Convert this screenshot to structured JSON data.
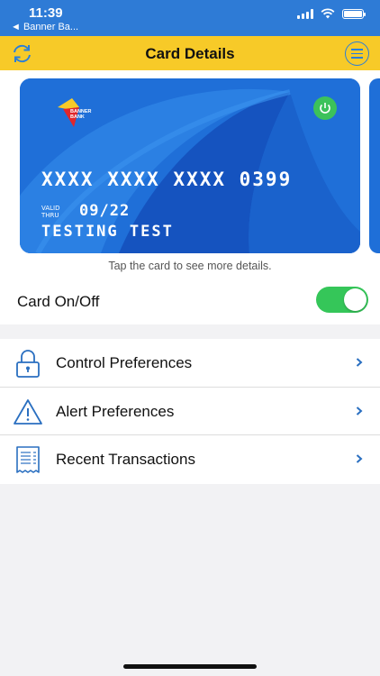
{
  "status_bar": {
    "time": "11:39",
    "back_app": "◄ Banner Ba..."
  },
  "nav": {
    "title": "Card Details",
    "left_icon": "refresh-icon",
    "right_icon": "menu-icon"
  },
  "card": {
    "bank_name": "BANNER BANK",
    "number": "XXXX XXXX XXXX 0399",
    "valid_label_1": "VALID",
    "valid_label_2": "THRU",
    "expiry": "09/22",
    "holder": "TESTING TEST",
    "color": "#1f6fd8",
    "power_color": "#3cc25a"
  },
  "tap_hint": "Tap the card to see more details.",
  "card_toggle": {
    "label": "Card On/Off",
    "on": true,
    "color": "#35c659"
  },
  "menu": {
    "items": [
      {
        "label": "Control Preferences",
        "icon": "lock-icon"
      },
      {
        "label": "Alert Preferences",
        "icon": "warning-icon"
      },
      {
        "label": "Recent Transactions",
        "icon": "receipt-icon"
      }
    ]
  },
  "colors": {
    "nav_yellow": "#f7ca28",
    "accent_blue": "#2a7ed8"
  }
}
